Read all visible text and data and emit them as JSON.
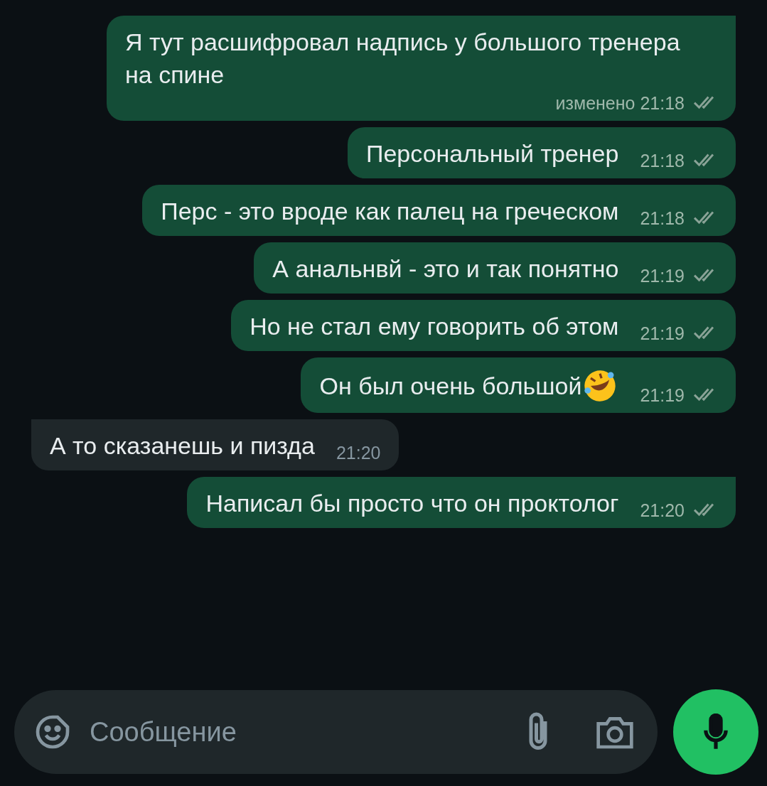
{
  "messages": [
    {
      "outgoing": true,
      "text": "Я тут расшифровал надпись у большого тренера на спине",
      "edited": "изменено",
      "time": "21:18",
      "read": false,
      "tail": true
    },
    {
      "outgoing": true,
      "text": "Персональный тренер",
      "time": "21:18",
      "read": false,
      "tail": false
    },
    {
      "outgoing": true,
      "text": "Перс - это вроде как палец на греческом",
      "time": "21:18",
      "read": false,
      "tail": false
    },
    {
      "outgoing": true,
      "text": "А анальнвй - это и так понятно",
      "time": "21:19",
      "read": false,
      "tail": false
    },
    {
      "outgoing": true,
      "text": "Но не стал ему говорить об этом",
      "time": "21:19",
      "read": false,
      "tail": false
    },
    {
      "outgoing": true,
      "text": "Он был очень большой",
      "emoji": true,
      "time": "21:19",
      "read": false,
      "tail": false
    },
    {
      "outgoing": false,
      "text": "А то сказанешь и пизда",
      "time": "21:20",
      "tail": true
    },
    {
      "outgoing": true,
      "text": "Написал бы просто что он проктолог",
      "time": "21:20",
      "read": false,
      "tail": true
    }
  ],
  "composer": {
    "placeholder": "Сообщение"
  }
}
